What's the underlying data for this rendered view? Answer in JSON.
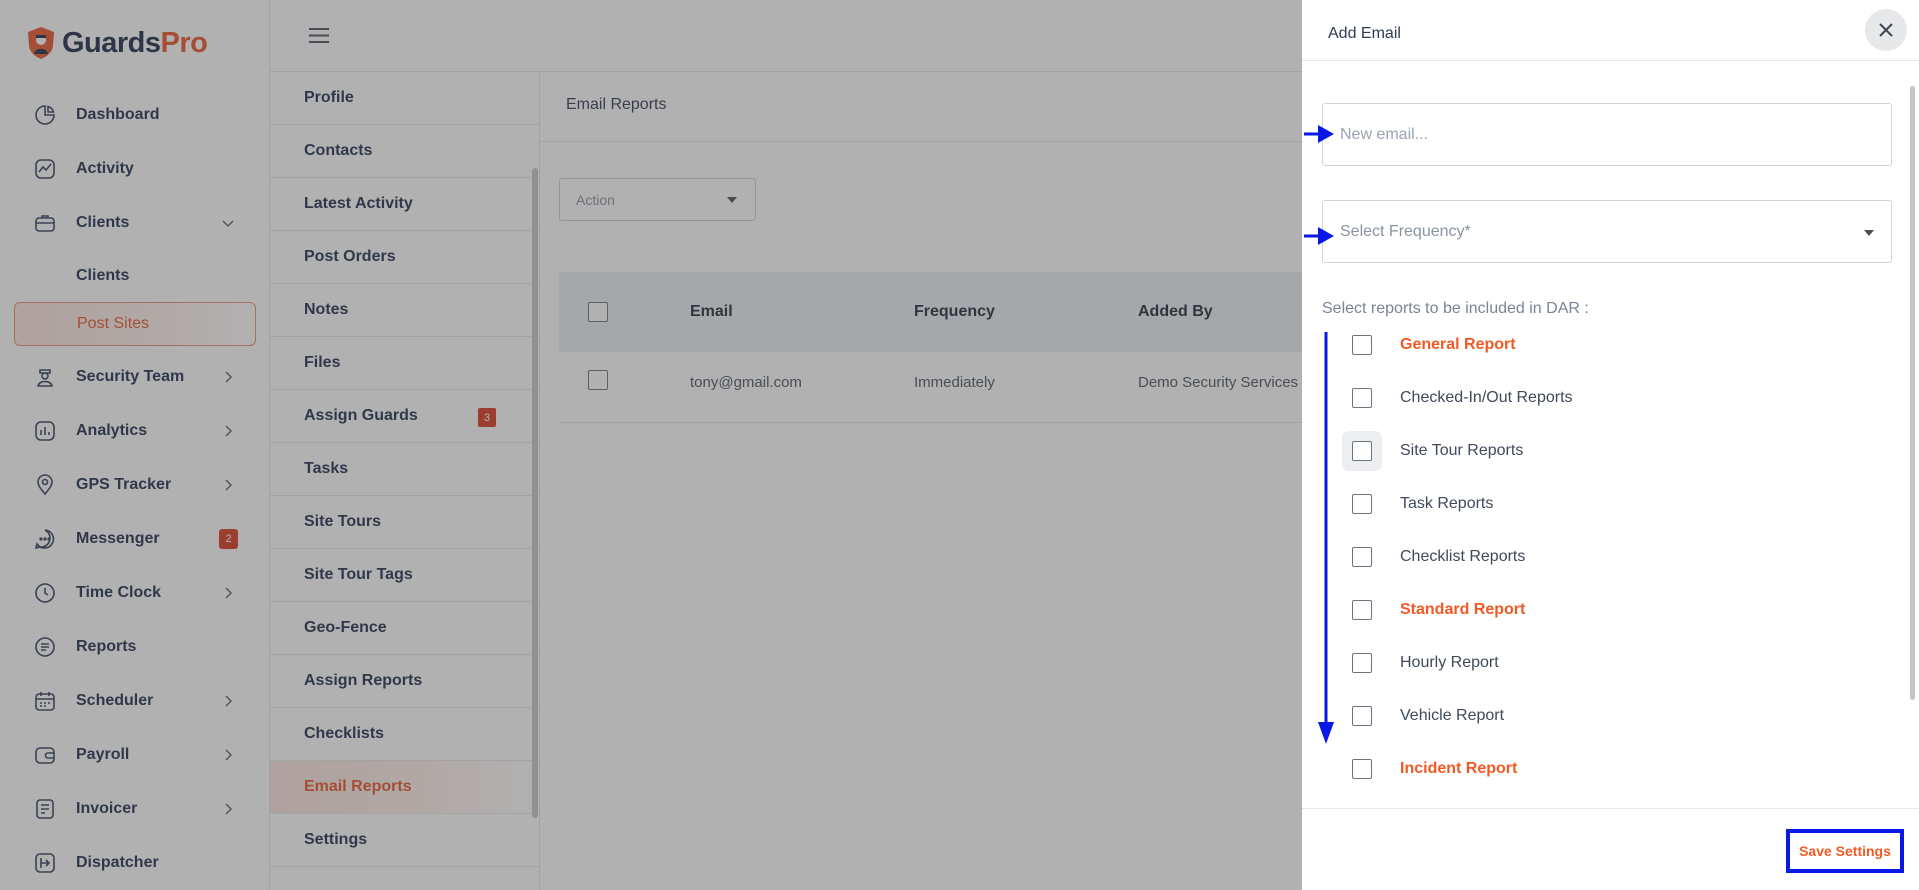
{
  "brand": {
    "name_part1": "Guards",
    "name_part2": "Pro"
  },
  "sidebar": {
    "items": [
      {
        "label": "Dashboard",
        "icon": "dashboard-icon"
      },
      {
        "label": "Activity",
        "icon": "activity-icon"
      },
      {
        "label": "Clients",
        "icon": "briefcase-icon",
        "expanded": true
      },
      {
        "label": "Clients",
        "sub": true
      },
      {
        "label": "Post Sites",
        "sub": true,
        "active": true
      },
      {
        "label": "Security Team",
        "icon": "guard-icon",
        "chevron": true
      },
      {
        "label": "Analytics",
        "icon": "analytics-icon",
        "chevron": true
      },
      {
        "label": "GPS Tracker",
        "icon": "location-icon",
        "chevron": true
      },
      {
        "label": "Messenger",
        "icon": "chat-icon",
        "badge": "2"
      },
      {
        "label": "Time Clock",
        "icon": "clock-icon",
        "chevron": true
      },
      {
        "label": "Reports",
        "icon": "reports-icon"
      },
      {
        "label": "Scheduler",
        "icon": "calendar-icon",
        "chevron": true
      },
      {
        "label": "Payroll",
        "icon": "wallet-icon",
        "chevron": true
      },
      {
        "label": "Invoicer",
        "icon": "invoice-icon",
        "chevron": true
      },
      {
        "label": "Dispatcher",
        "icon": "dispatch-icon"
      }
    ]
  },
  "subnav": {
    "items": [
      {
        "label": "Profile"
      },
      {
        "label": "Contacts"
      },
      {
        "label": "Latest Activity"
      },
      {
        "label": "Post Orders"
      },
      {
        "label": "Notes"
      },
      {
        "label": "Files"
      },
      {
        "label": "Assign Guards",
        "badge": "3"
      },
      {
        "label": "Tasks"
      },
      {
        "label": "Site Tours"
      },
      {
        "label": "Site Tour Tags"
      },
      {
        "label": "Geo-Fence"
      },
      {
        "label": "Assign Reports"
      },
      {
        "label": "Checklists"
      },
      {
        "label": "Email Reports",
        "active": true
      },
      {
        "label": "Settings"
      }
    ]
  },
  "main": {
    "title": "Email Reports",
    "action_placeholder": "Action",
    "table": {
      "headers": [
        "Email",
        "Frequency",
        "Added By"
      ],
      "rows": [
        {
          "email": "tony@gmail.com",
          "frequency": "Immediately",
          "added_by": "Demo Security Services"
        }
      ]
    }
  },
  "drawer": {
    "title": "Add Email",
    "email_placeholder": "New email...",
    "frequency_placeholder": "Select Frequency*",
    "dar_label": "Select reports to be included in DAR :",
    "reports": [
      {
        "label": "General Report",
        "header": true
      },
      {
        "label": "Checked-In/Out Reports"
      },
      {
        "label": "Site Tour Reports",
        "focused": true
      },
      {
        "label": "Task Reports"
      },
      {
        "label": "Checklist Reports"
      },
      {
        "label": "Standard Report",
        "header": true
      },
      {
        "label": "Hourly Report"
      },
      {
        "label": "Vehicle Report"
      },
      {
        "label": "Incident Report",
        "header": true
      }
    ],
    "save_label": "Save Settings"
  },
  "colors": {
    "accent": "#f15a24",
    "navy": "#1f2d4d",
    "annotation_blue": "#0a18e6",
    "badge_red": "#d9391c"
  }
}
